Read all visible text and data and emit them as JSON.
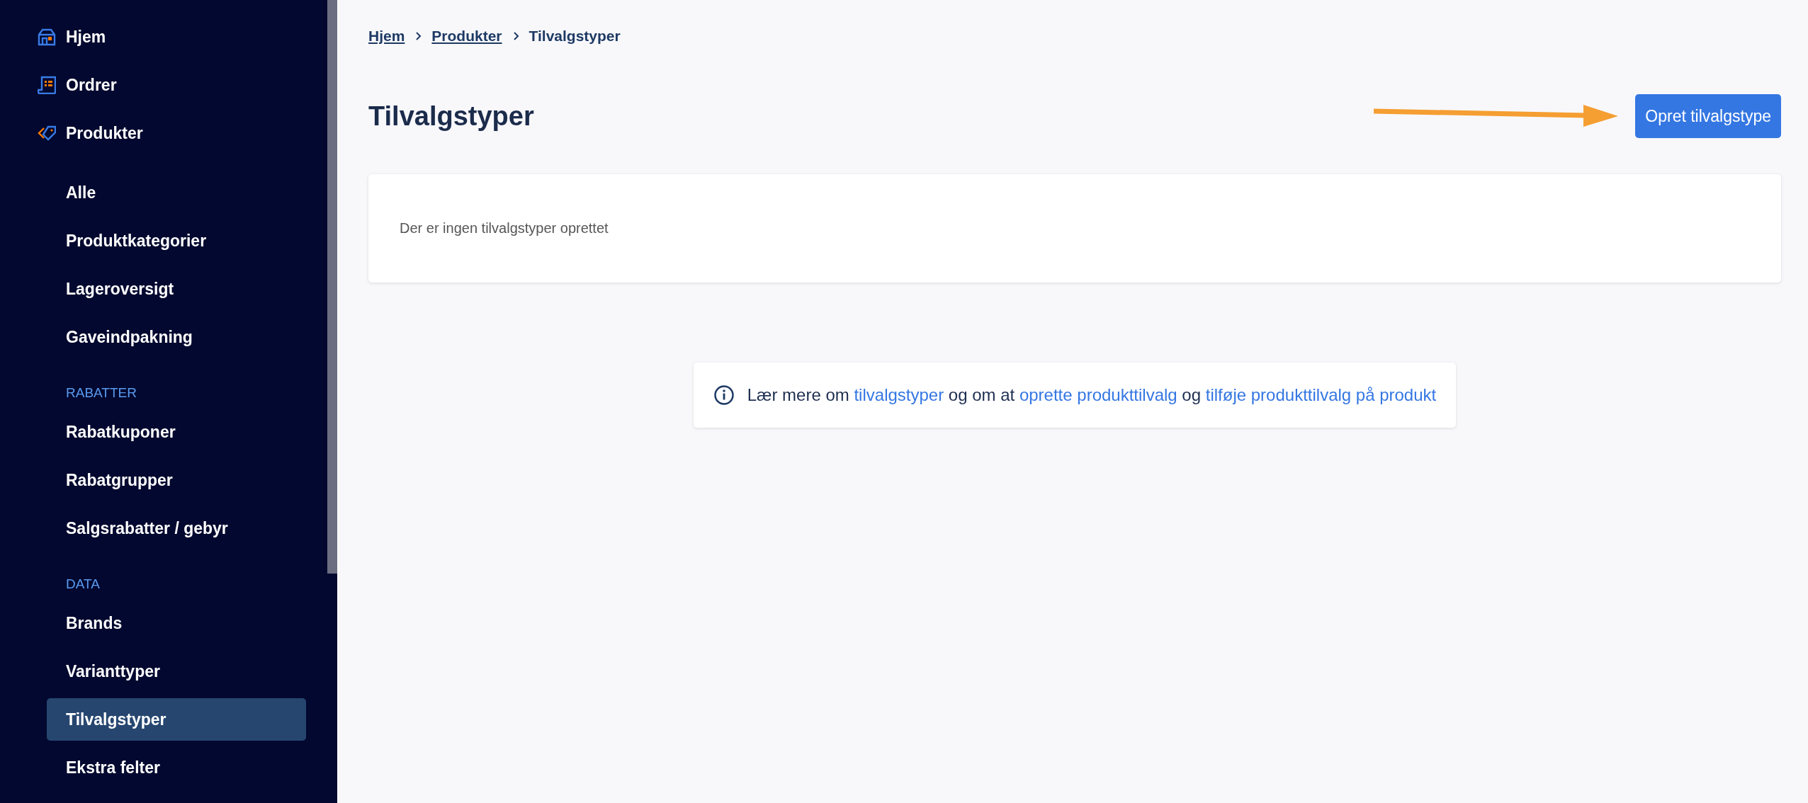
{
  "sidebar": {
    "items": [
      {
        "kind": "item",
        "label": "Hjem",
        "selected": false
      },
      {
        "kind": "item",
        "label": "Ordrer",
        "selected": false
      },
      {
        "kind": "item",
        "label": "Produkter",
        "selected": false
      },
      {
        "kind": "subitem",
        "label": "Alle",
        "selected": false
      },
      {
        "kind": "subitem",
        "label": "Produktkategorier",
        "selected": false
      },
      {
        "kind": "subitem",
        "label": "Lageroversigt",
        "selected": false
      },
      {
        "kind": "subitem",
        "label": "Gaveindpakning",
        "selected": false
      },
      {
        "kind": "heading",
        "label": "RABATTER"
      },
      {
        "kind": "subitem",
        "label": "Rabatkuponer",
        "selected": false
      },
      {
        "kind": "subitem",
        "label": "Rabatgrupper",
        "selected": false
      },
      {
        "kind": "subitem",
        "label": "Salgsrabatter / gebyr",
        "selected": false
      },
      {
        "kind": "heading",
        "label": "DATA"
      },
      {
        "kind": "subitem",
        "label": "Brands",
        "selected": false
      },
      {
        "kind": "subitem",
        "label": "Varianttyper",
        "selected": false
      },
      {
        "kind": "subitem",
        "label": "Tilvalgstyper",
        "selected": true
      },
      {
        "kind": "subitem",
        "label": "Ekstra felter",
        "selected": false
      }
    ]
  },
  "breadcrumb": [
    {
      "label": "Hjem",
      "kind": "link"
    },
    {
      "label": "Produkter",
      "kind": "link"
    },
    {
      "label": "Tilvalgstyper",
      "kind": "current"
    }
  ],
  "title": "Tilvalgstyper",
  "create_button": "Opret tilvalgstype",
  "empty_message": "Der er ingen tilvalgstyper oprettet",
  "info": {
    "parts": [
      {
        "kind": "text",
        "text": "Lær mere om "
      },
      {
        "kind": "link",
        "text": "tilvalgstyper"
      },
      {
        "kind": "text",
        "text": " og om at "
      },
      {
        "kind": "link",
        "text": "oprette produkttilvalg"
      },
      {
        "kind": "text",
        "text": " og "
      },
      {
        "kind": "link",
        "text": "tilføje produkttilvalg på produkt"
      }
    ]
  }
}
